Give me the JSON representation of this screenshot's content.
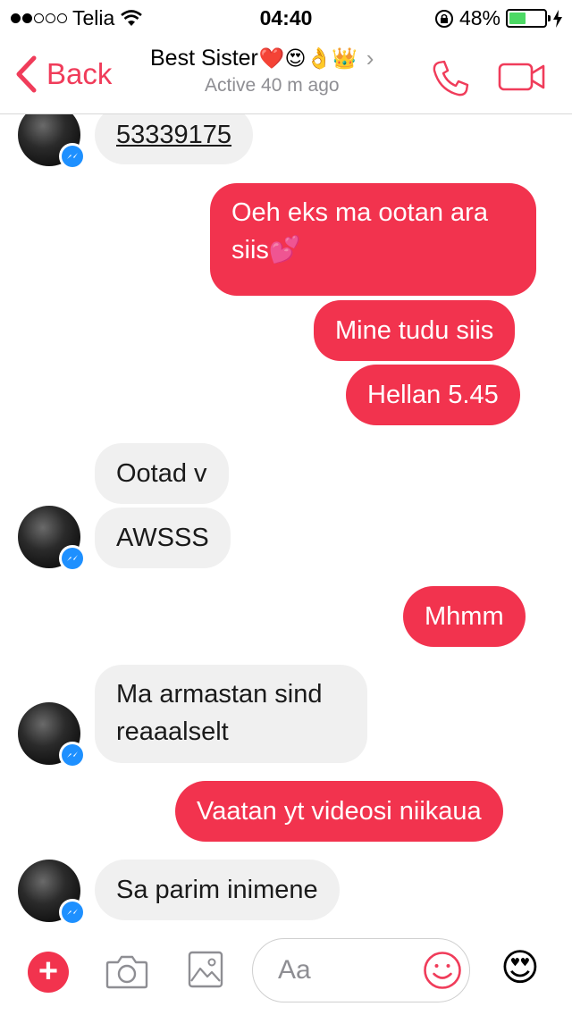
{
  "status_bar": {
    "carrier": "Telia",
    "time": "04:40",
    "battery_percent_label": "48%",
    "battery_level": 0.48
  },
  "header": {
    "back_label": "Back",
    "contact_name": "Best Sister",
    "name_emojis": "❤️😍👌👑",
    "chevron": "›",
    "active_status": "Active 40 m ago"
  },
  "messages": [
    {
      "side": "received",
      "text": "53339175",
      "underlined": true
    },
    {
      "side": "sent",
      "text": "Oeh eks ma ootan ara siis💕"
    },
    {
      "side": "sent",
      "text": "Mine tudu siis"
    },
    {
      "side": "sent",
      "text": "Hellan 5.45"
    },
    {
      "side": "received",
      "text": "Ootad v"
    },
    {
      "side": "received",
      "text": "AWSSS"
    },
    {
      "side": "sent",
      "text": "Mhmm"
    },
    {
      "side": "received",
      "text": "Ma armastan sind reaaalselt"
    },
    {
      "side": "sent",
      "text": "Vaatan yt videosi niikaua"
    },
    {
      "side": "received",
      "text": "Sa parim inimene"
    }
  ],
  "composer": {
    "plus_label": "+",
    "placeholder": "Aa",
    "emoji": "😍"
  },
  "colors": {
    "accent": "#f03c5a",
    "sent_bubble": "#f2334e",
    "received_bubble": "#f0f0f0",
    "messenger_badge": "#1e90ff",
    "battery_fill": "#4cd964"
  }
}
